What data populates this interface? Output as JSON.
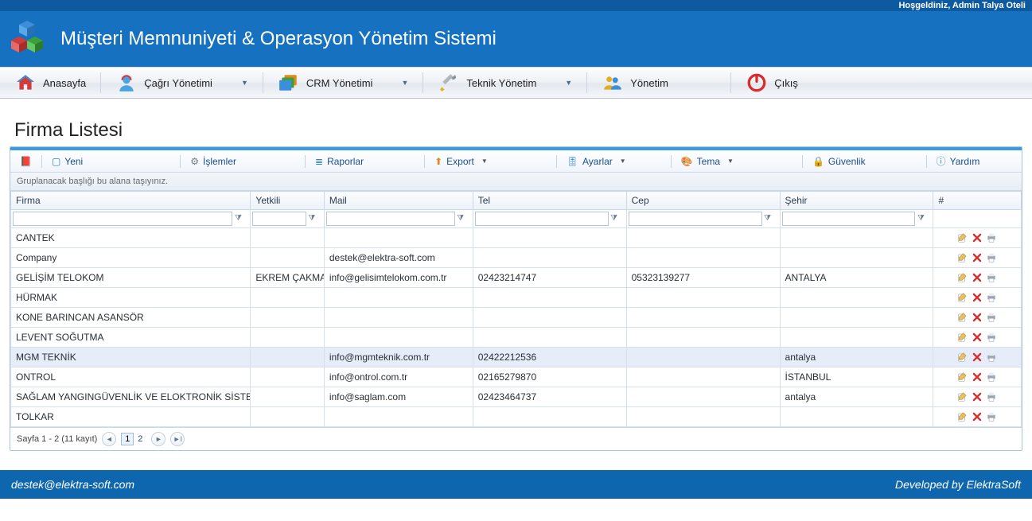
{
  "topbar": {
    "welcome": "Hoşgeldiniz, Admin Talya Oteli"
  },
  "banner": {
    "title": "Müşteri Memnuniyeti & Operasyon Yönetim Sistemi"
  },
  "nav": {
    "home": "Anasayfa",
    "call": "Çağrı Yönetimi",
    "crm": "CRM Yönetimi",
    "tech": "Teknik Yönetim",
    "admin": "Yönetim",
    "exit": "Çıkış"
  },
  "page": {
    "title": "Firma Listesi"
  },
  "toolbar": {
    "new_": "Yeni",
    "ops": "İşlemler",
    "reports": "Raporlar",
    "export_": "Export",
    "settings": "Ayarlar",
    "theme": "Tema",
    "security": "Güvenlik",
    "help": "Yardım"
  },
  "grid": {
    "group_hint": "Gruplanacak başlığı bu alana taşıyınız.",
    "cols": {
      "firma": "Firma",
      "yetkili": "Yetkili",
      "mail": "Mail",
      "tel": "Tel",
      "cep": "Cep",
      "sehir": "Şehir",
      "act": "#"
    },
    "rows": [
      {
        "firma": "CANTEK",
        "yetkili": "",
        "mail": "",
        "tel": "",
        "cep": "",
        "sehir": ""
      },
      {
        "firma": "Company",
        "yetkili": "",
        "mail": "destek@elektra-soft.com",
        "tel": "",
        "cep": "",
        "sehir": ""
      },
      {
        "firma": "GELİŞİM TELOKOM",
        "yetkili": "EKREM ÇAKMAK",
        "mail": "info@gelisimtelokom.com.tr",
        "tel": "02423214747",
        "cep": "05323139277",
        "sehir": "ANTALYA"
      },
      {
        "firma": "HÜRMAK",
        "yetkili": "",
        "mail": "",
        "tel": "",
        "cep": "",
        "sehir": ""
      },
      {
        "firma": "KONE BARINCAN ASANSÖR",
        "yetkili": "",
        "mail": "",
        "tel": "",
        "cep": "",
        "sehir": ""
      },
      {
        "firma": "LEVENT SOĞUTMA",
        "yetkili": "",
        "mail": "",
        "tel": "",
        "cep": "",
        "sehir": ""
      },
      {
        "firma": "MGM TEKNİK",
        "yetkili": "",
        "mail": "info@mgmteknik.com.tr",
        "tel": "02422212536",
        "cep": "",
        "sehir": "antalya",
        "hl": true
      },
      {
        "firma": "ONTROL",
        "yetkili": "",
        "mail": "info@ontrol.com.tr",
        "tel": "02165279870",
        "cep": "",
        "sehir": "İSTANBUL"
      },
      {
        "firma": "SAĞLAM YANGINGÜVENLİK VE ELOKTRONİK SİSTEM",
        "yetkili": "",
        "mail": "info@saglam.com",
        "tel": "02423464737",
        "cep": "",
        "sehir": "antalya"
      },
      {
        "firma": "TOLKAR",
        "yetkili": "",
        "mail": "",
        "tel": "",
        "cep": "",
        "sehir": ""
      }
    ]
  },
  "pager": {
    "summary": "Sayfa 1 - 2 (11 kayıt)",
    "pages": [
      "1",
      "2"
    ],
    "current": "1"
  },
  "footer": {
    "left": "destek@elektra-soft.com",
    "right": "Developed by ElektraSoft"
  }
}
